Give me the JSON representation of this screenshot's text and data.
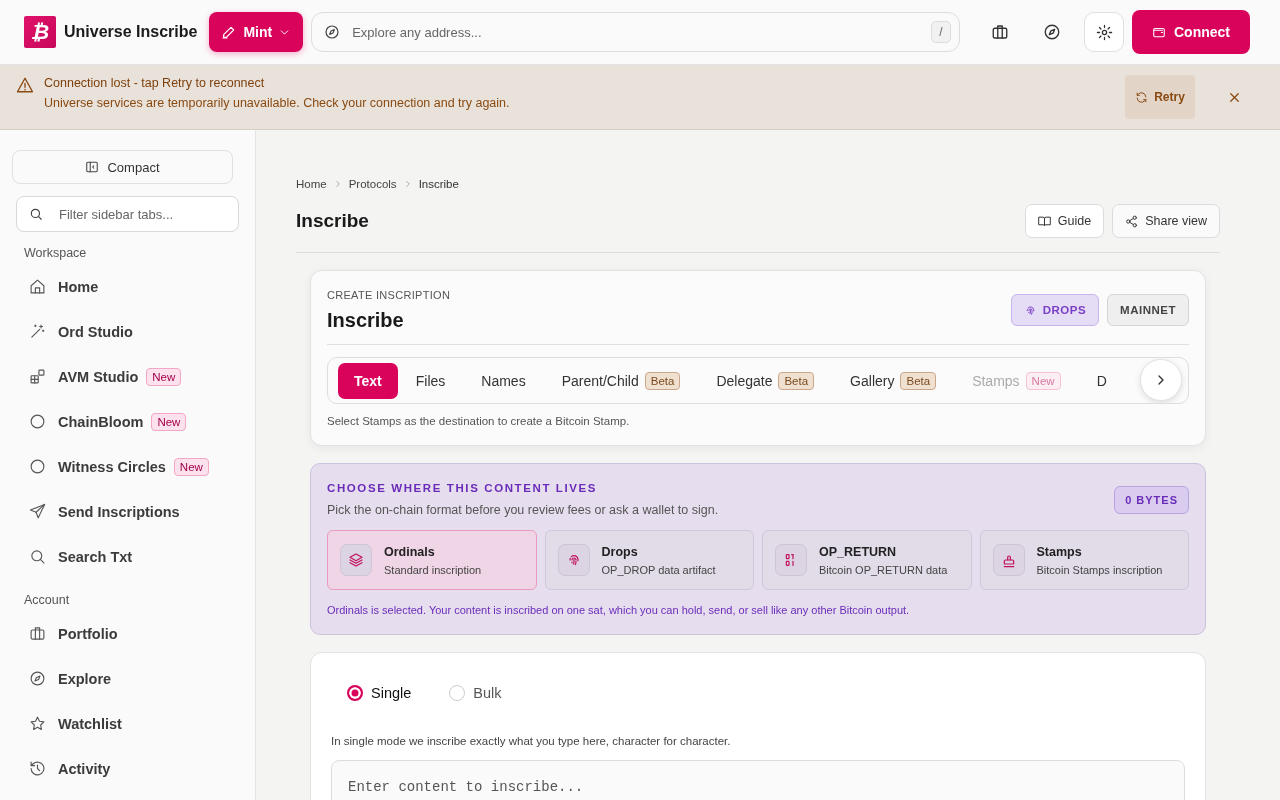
{
  "header": {
    "brand_mark": "₿",
    "brand": "Universe Inscribe",
    "mint_button": "Mint",
    "search": {
      "placeholder": "Explore any address...",
      "shortcut": "/"
    },
    "connect_button": "Connect"
  },
  "alert": {
    "title": "Connection lost - tap Retry to reconnect",
    "message": "Universe services are temporarily unavailable. Check your connection and try again.",
    "retry_button": "Retry"
  },
  "sidebar": {
    "compact_button": "Compact",
    "filter": {
      "placeholder": "Filter sidebar tabs..."
    },
    "sections": [
      {
        "title": "Workspace",
        "items": [
          {
            "label": "Home",
            "selected": false
          },
          {
            "label": "Ord Studio",
            "selected": false
          },
          {
            "label": "AVM Studio",
            "badge": "New",
            "selected": false
          },
          {
            "label": "ChainBloom",
            "badge": "New",
            "selected": false
          },
          {
            "label": "Witness Circles",
            "badge": "New",
            "selected": false
          },
          {
            "label": "Send Inscriptions",
            "selected": false
          },
          {
            "label": "Search Txt",
            "selected": false
          }
        ]
      },
      {
        "title": "Account",
        "items": [
          {
            "label": "Portfolio",
            "selected": false
          },
          {
            "label": "Explore",
            "selected": false
          },
          {
            "label": "Watchlist",
            "selected": false
          },
          {
            "label": "Activity",
            "selected": false
          }
        ]
      }
    ]
  },
  "breadcrumbs": [
    "Home",
    "Protocols",
    "Inscribe"
  ],
  "page_title": "Inscribe",
  "actions": [
    "Guide",
    "Share view"
  ],
  "create_card": {
    "eyebrow": "CREATE INSCRIPTION",
    "title": "Inscribe",
    "tags": [
      {
        "label": "DROPS",
        "kind": "protocol"
      },
      {
        "label": "MAINNET",
        "kind": "network"
      }
    ],
    "tabs": [
      {
        "label": "Text",
        "selected": true,
        "disabled": false
      },
      {
        "label": "Files",
        "selected": false,
        "disabled": false
      },
      {
        "label": "Names",
        "selected": false,
        "disabled": false
      },
      {
        "label": "Parent/Child",
        "badge": "Beta",
        "selected": false,
        "disabled": false
      },
      {
        "label": "Delegate",
        "badge": "Beta",
        "selected": false,
        "disabled": false
      },
      {
        "label": "Gallery",
        "badge": "Beta",
        "selected": false,
        "disabled": false
      },
      {
        "label": "Stamps",
        "badge": "New",
        "selected": false,
        "disabled": true
      },
      {
        "label": "D",
        "selected": false,
        "disabled": false
      }
    ],
    "hint": "Select Stamps as the destination to create a Bitcoin Stamp."
  },
  "destination": {
    "title": "CHOOSE WHERE THIS CONTENT LIVES",
    "subtitle": "Pick the on-chain format before you review fees or ask a wallet to sign.",
    "size_badge": "0 BYTES",
    "options": [
      {
        "title": "Ordinals",
        "description": "Standard inscription",
        "selected": true
      },
      {
        "title": "Drops",
        "description": "OP_DROP data artifact",
        "selected": false
      },
      {
        "title": "OP_RETURN",
        "description": "Bitcoin OP_RETURN data",
        "selected": false
      },
      {
        "title": "Stamps",
        "description": "Bitcoin Stamps inscription",
        "selected": false
      }
    ],
    "note": "Ordinals is selected. Your content is inscribed on one sat, which you can hold, send, or sell like any other Bitcoin output."
  },
  "content": {
    "modes": [
      {
        "label": "Single",
        "selected": true
      },
      {
        "label": "Bulk",
        "selected": false
      }
    ],
    "help": "In single mode we inscribe exactly what you type here, character for character.",
    "editor": {
      "placeholder": "Enter content to inscribe..."
    }
  }
}
